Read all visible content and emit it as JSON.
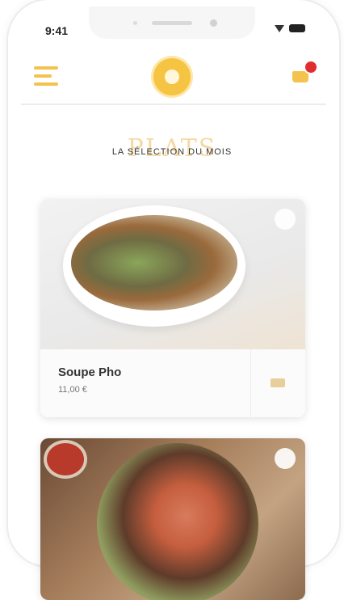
{
  "status_bar": {
    "time": "9:41"
  },
  "header": {
    "menu_icon": "hamburger-menu-icon",
    "logo_icon": "restaurant-logo-icon",
    "cart_icon": "shopping-cart-icon",
    "cart_badge_visible": true
  },
  "section": {
    "title": "PLATS",
    "subtitle": "LA SÉLECTION DU MOIS"
  },
  "cards": [
    {
      "name": "Soupe Pho",
      "price": "11,00 €",
      "favorite_icon": "heart-icon",
      "add_to_cart_icon": "cart-add-icon"
    },
    {
      "name": "",
      "price": "",
      "favorite_icon": "heart-icon",
      "add_to_cart_icon": "cart-add-icon"
    }
  ],
  "colors": {
    "accent": "#f3c34d",
    "badge": "#e02d2d",
    "title_faded": "#f5d9a2"
  }
}
